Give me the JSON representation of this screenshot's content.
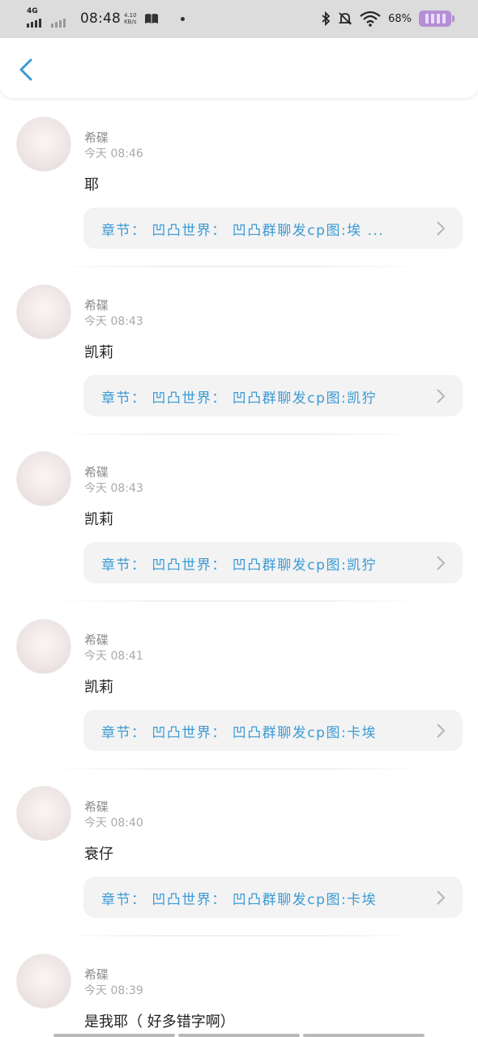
{
  "status_bar": {
    "network": "4G",
    "time": "08:48",
    "speed_value": "4.10",
    "speed_unit": "KB/s",
    "battery": "68%"
  },
  "colors": {
    "link": "#3a9ad5",
    "back_arrow": "#3a9ad5",
    "battery": "#b48fd6"
  },
  "header": {
    "back_icon": "chevron-left-icon"
  },
  "posts": [
    {
      "name": "希碟",
      "time": "今天 08:46",
      "content": "耶",
      "chapter": "章节： 凹凸世界： 凹凸群聊发cp图:埃 ..."
    },
    {
      "name": "希碟",
      "time": "今天 08:43",
      "content": "凯莉",
      "chapter": "章节： 凹凸世界： 凹凸群聊发cp图:凯狞"
    },
    {
      "name": "希碟",
      "time": "今天 08:43",
      "content": "凯莉",
      "chapter": "章节： 凹凸世界： 凹凸群聊发cp图:凯狞"
    },
    {
      "name": "希碟",
      "time": "今天 08:41",
      "content": "凯莉",
      "chapter": "章节： 凹凸世界： 凹凸群聊发cp图:卡埃"
    },
    {
      "name": "希碟",
      "time": "今天 08:40",
      "content": "衰仔",
      "chapter": "章节： 凹凸世界： 凹凸群聊发cp图:卡埃"
    },
    {
      "name": "希碟",
      "time": "今天 08:39",
      "content": "是我耶（ 好多错字啊）",
      "chapter": ""
    }
  ]
}
